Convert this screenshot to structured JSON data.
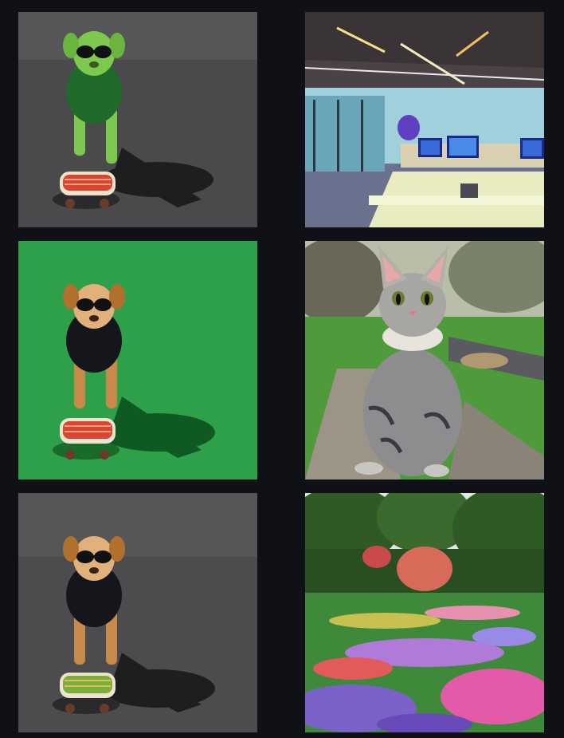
{
  "gallery": {
    "background": "#0f1117",
    "images": [
      {
        "subject": "dog-skateboard-green-tint-icon",
        "palette": {
          "ground": "#4a4a4c",
          "dog": "#7ec850",
          "shirt": "#1f6a2a",
          "board": "#d9452e"
        }
      },
      {
        "subject": "office-room-icon",
        "palette": {
          "ceiling": "#3a3436",
          "wall": "#9fd0dc",
          "desk": "#e8ecc0",
          "floor": "#6a7290"
        }
      },
      {
        "subject": "dog-skateboard-green-ground-icon",
        "palette": {
          "ground": "#2fa04a",
          "dog": "#c88a4a",
          "shirt": "#14161c",
          "board": "#d9452e"
        }
      },
      {
        "subject": "cat-in-garden-icon",
        "palette": {
          "cat": "#8d8d90",
          "grass": "#4f9a3a",
          "path": "#9c9486",
          "trees": "#5c6a50"
        }
      },
      {
        "subject": "dog-skateboard-asphalt-icon",
        "palette": {
          "ground": "#4c4c4e",
          "dog": "#c88a4a",
          "shirt": "#14161c",
          "board": "#7cae3a"
        }
      },
      {
        "subject": "flower-garden-icon",
        "palette": {
          "trees": "#2f5a26",
          "purple": "#7a62c8",
          "pink": "#e25aa8",
          "green": "#3f8a3a"
        }
      }
    ]
  }
}
